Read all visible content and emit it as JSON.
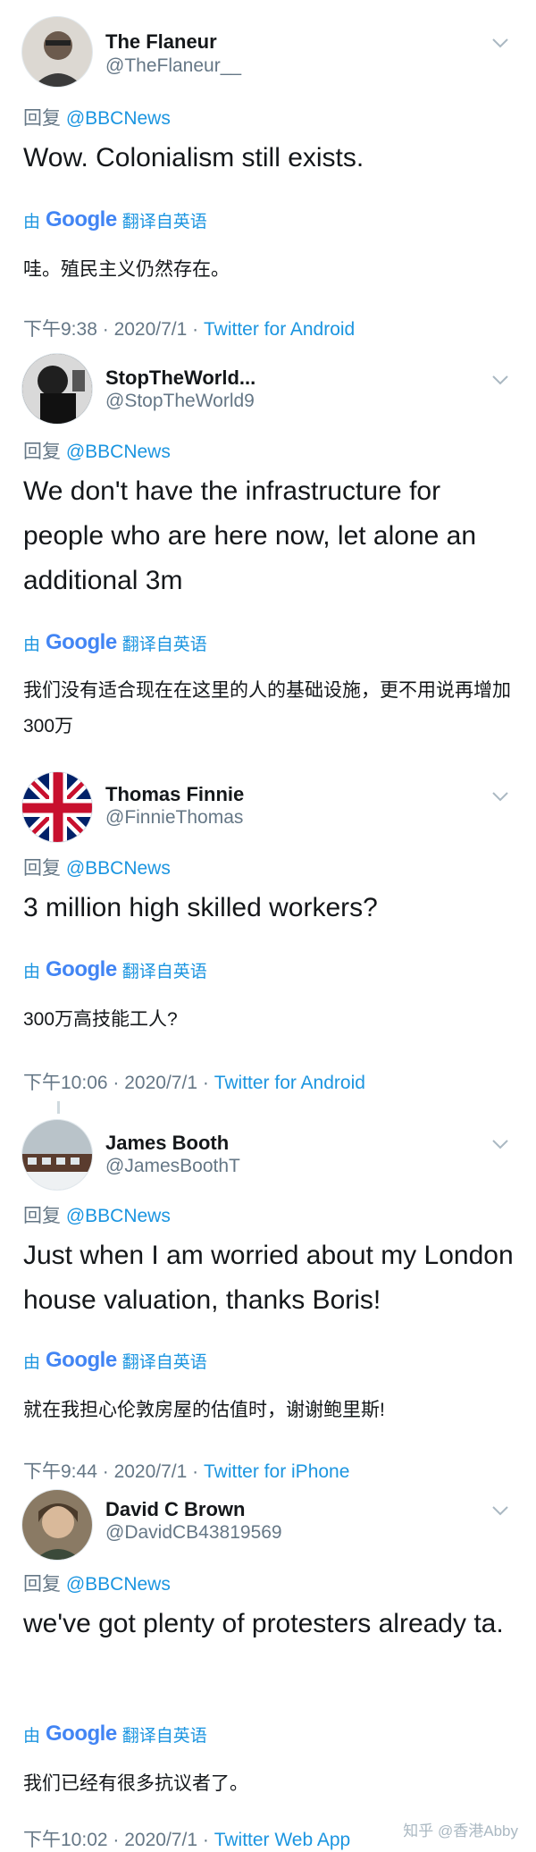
{
  "labels": {
    "reply_prefix": "回复",
    "translated_by_prefix": "由",
    "translated_by_suffix": "翻译自英语",
    "google": "Google",
    "separator": "·"
  },
  "tweets": [
    {
      "name": "The Flaneur",
      "handle": "@TheFlaneur__",
      "reply_to": "@BBCNews",
      "text": "Wow. Colonialism still exists.",
      "translation": "哇。殖民主义仍然存在。",
      "time": "下午9:38",
      "date": "2020/7/1",
      "source": "Twitter for Android"
    },
    {
      "name": "StopTheWorld...",
      "handle": "@StopTheWorld9",
      "reply_to": "@BBCNews",
      "text": "We don't have the infrastructure for people who are here now, let alone an additional 3m",
      "translation": "我们没有适合现在在这里的人的基础设施，更不用说再增加300万",
      "time": "",
      "date": "",
      "source": ""
    },
    {
      "name": "Thomas Finnie",
      "handle": "@FinnieThomas",
      "reply_to": "@BBCNews",
      "text": "3 million high skilled workers?",
      "translation": "300万高技能工人?",
      "time": "下午10:06",
      "date": "2020/7/1",
      "source": "Twitter for Android"
    },
    {
      "name": "James Booth",
      "handle": "@JamesBoothT",
      "reply_to": "@BBCNews",
      "text": "Just when I am worried about my London house valuation, thanks Boris!",
      "translation": "就在我担心伦敦房屋的估值时，谢谢鲍里斯!",
      "time": "下午9:44",
      "date": "2020/7/1",
      "source": "Twitter for iPhone"
    },
    {
      "name": "David C Brown",
      "handle": "@DavidCB43819569",
      "reply_to": "@BBCNews",
      "text": "we've got plenty of protesters already ta.",
      "translation": "我们已经有很多抗议者了。",
      "time": "下午10:02",
      "date": "2020/7/1",
      "source": "Twitter Web App"
    }
  ],
  "watermark": "知乎 @香港Abby",
  "colors": {
    "link": "#1b95e0",
    "muted": "#657786",
    "text": "#14171a"
  }
}
